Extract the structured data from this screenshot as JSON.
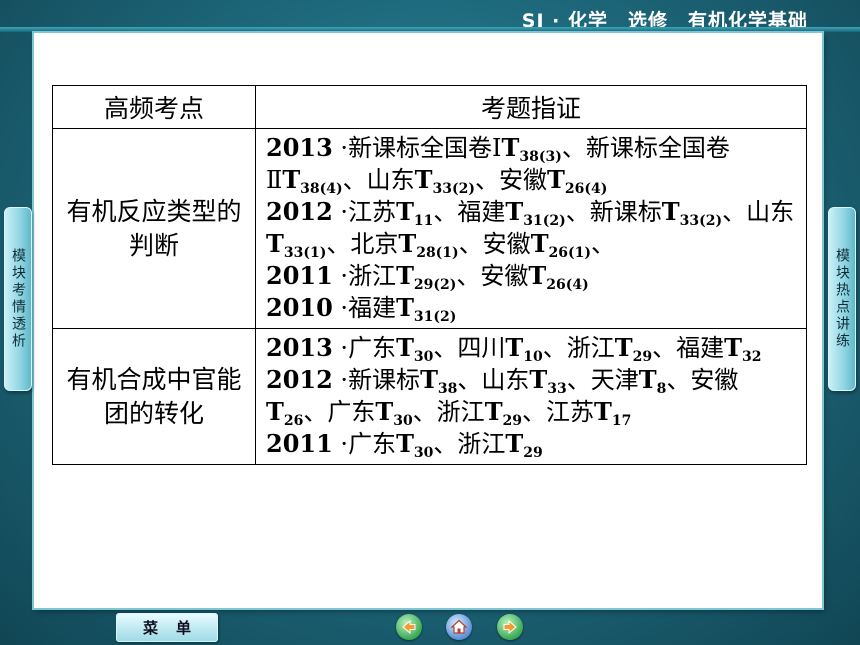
{
  "header": {
    "title": "SJ · 化学　选修　有机化学基础"
  },
  "table": {
    "headers": [
      "高频考点",
      "考题指证"
    ],
    "rows": [
      {
        "topic": "有机反应类型的判断",
        "lines": [
          [
            {
              "t": "2013",
              "k": "yr"
            },
            {
              "t": " ·",
              "k": "dot"
            },
            {
              "t": "新课标全国卷Ⅰ",
              "k": "cn"
            },
            {
              "t": "T"
            },
            {
              "t": "38(3)",
              "k": "sub"
            },
            {
              "t": "、新课标全国卷Ⅱ",
              "k": "cn"
            },
            {
              "t": "T"
            },
            {
              "t": "38(4)",
              "k": "sub"
            },
            {
              "t": "、山东",
              "k": "cn"
            },
            {
              "t": "T"
            },
            {
              "t": "33(2)",
              "k": "sub"
            },
            {
              "t": "、安徽",
              "k": "cn"
            },
            {
              "t": "T"
            },
            {
              "t": "26(4)",
              "k": "sub"
            }
          ],
          [
            {
              "t": "2012",
              "k": "yr"
            },
            {
              "t": " ·",
              "k": "dot"
            },
            {
              "t": "江苏",
              "k": "cn"
            },
            {
              "t": "T"
            },
            {
              "t": "11",
              "k": "sub"
            },
            {
              "t": "、福建",
              "k": "cn"
            },
            {
              "t": "T"
            },
            {
              "t": "31(2)",
              "k": "sub"
            },
            {
              "t": "、新课标",
              "k": "cn"
            },
            {
              "t": "T"
            },
            {
              "t": "33(2)",
              "k": "sub"
            },
            {
              "t": "、山东",
              "k": "cn"
            },
            {
              "t": "T"
            },
            {
              "t": "33(1)",
              "k": "sub"
            },
            {
              "t": "、北京",
              "k": "cn"
            },
            {
              "t": "T"
            },
            {
              "t": "28(1)",
              "k": "sub"
            },
            {
              "t": "、安徽",
              "k": "cn"
            },
            {
              "t": "T"
            },
            {
              "t": "26(1)",
              "k": "sub"
            },
            {
              "t": "、",
              "k": "cn"
            }
          ],
          [
            {
              "t": "2011",
              "k": "yr"
            },
            {
              "t": " ·",
              "k": "dot"
            },
            {
              "t": "浙江",
              "k": "cn"
            },
            {
              "t": "T"
            },
            {
              "t": "29(2)",
              "k": "sub"
            },
            {
              "t": "、安徽",
              "k": "cn"
            },
            {
              "t": "T"
            },
            {
              "t": "26(4)",
              "k": "sub"
            }
          ],
          [
            {
              "t": "2010",
              "k": "yr"
            },
            {
              "t": " ·",
              "k": "dot"
            },
            {
              "t": "福建",
              "k": "cn"
            },
            {
              "t": "T"
            },
            {
              "t": "31(2)",
              "k": "sub"
            }
          ]
        ]
      },
      {
        "topic": "有机合成中官能团的转化",
        "lines": [
          [
            {
              "t": "2013",
              "k": "yr"
            },
            {
              "t": " ·",
              "k": "dot"
            },
            {
              "t": "广东",
              "k": "cn"
            },
            {
              "t": "T"
            },
            {
              "t": "30",
              "k": "sub"
            },
            {
              "t": "、四川",
              "k": "cn"
            },
            {
              "t": "T"
            },
            {
              "t": "10",
              "k": "sub"
            },
            {
              "t": "、浙江",
              "k": "cn"
            },
            {
              "t": "T"
            },
            {
              "t": "29",
              "k": "sub"
            },
            {
              "t": "、福建",
              "k": "cn"
            },
            {
              "t": "T"
            },
            {
              "t": "32",
              "k": "sub"
            }
          ],
          [
            {
              "t": "2012",
              "k": "yr"
            },
            {
              "t": " ·",
              "k": "dot"
            },
            {
              "t": "新课标",
              "k": "cn"
            },
            {
              "t": "T"
            },
            {
              "t": "38",
              "k": "sub"
            },
            {
              "t": "、山东",
              "k": "cn"
            },
            {
              "t": "T"
            },
            {
              "t": "33",
              "k": "sub"
            },
            {
              "t": "、天津",
              "k": "cn"
            },
            {
              "t": "T"
            },
            {
              "t": "8",
              "k": "sub"
            },
            {
              "t": "、安徽",
              "k": "cn"
            },
            {
              "t": "T"
            },
            {
              "t": "26",
              "k": "sub"
            },
            {
              "t": "、广东",
              "k": "cn"
            },
            {
              "t": "T"
            },
            {
              "t": "30",
              "k": "sub"
            },
            {
              "t": "、浙江",
              "k": "cn"
            },
            {
              "t": "T"
            },
            {
              "t": "29",
              "k": "sub"
            },
            {
              "t": "、江苏",
              "k": "cn"
            },
            {
              "t": "T"
            },
            {
              "t": "17",
              "k": "sub"
            }
          ],
          [
            {
              "t": "2011",
              "k": "yr"
            },
            {
              "t": " ·",
              "k": "dot"
            },
            {
              "t": "广东",
              "k": "cn"
            },
            {
              "t": "T"
            },
            {
              "t": "30",
              "k": "sub"
            },
            {
              "t": "、浙江",
              "k": "cn"
            },
            {
              "t": "T"
            },
            {
              "t": "29",
              "k": "sub"
            }
          ]
        ]
      }
    ]
  },
  "side_tabs": {
    "left": "模块考情透析",
    "right": "模块热点讲练"
  },
  "bottom": {
    "menu_label": "菜单"
  },
  "icons": {
    "prev": "arrow-left-icon",
    "home": "home-icon",
    "next": "arrow-right-icon"
  },
  "colors": {
    "background": "#1f6f82",
    "tab": "#9fdbe7",
    "slide": "#ffffff"
  }
}
